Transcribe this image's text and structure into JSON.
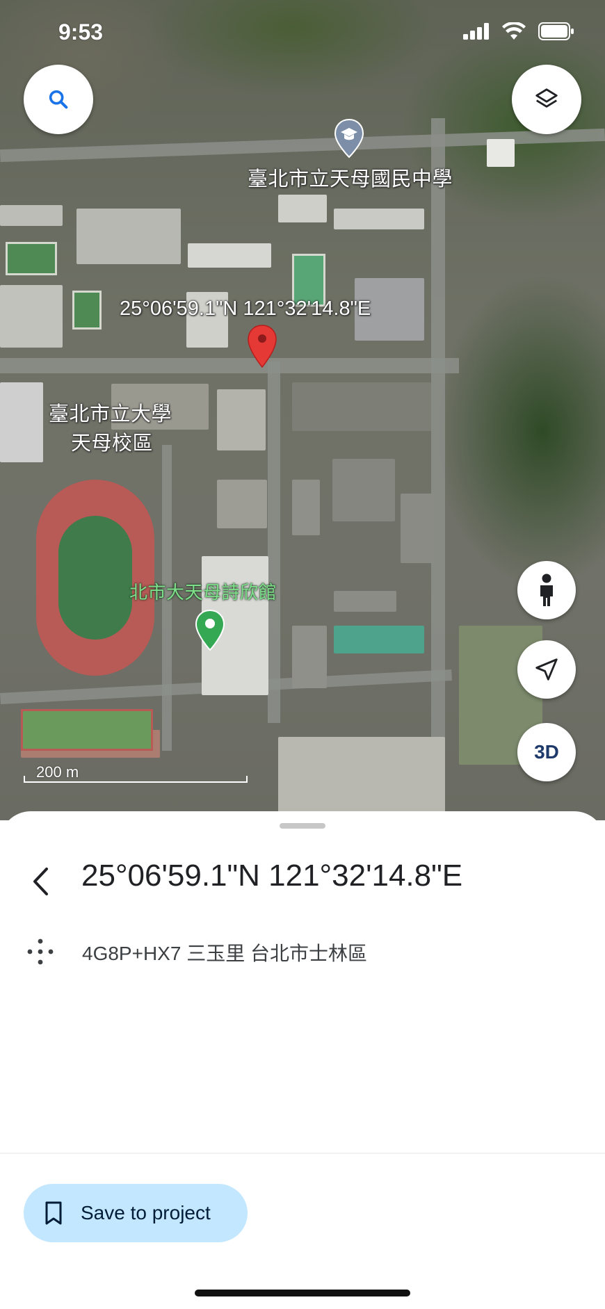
{
  "status_bar": {
    "time": "9:53"
  },
  "map": {
    "labels": {
      "junior_high": "臺北市立天母國民中學",
      "university_line1": "臺北市立大學",
      "university_line2": "天母校區",
      "poetry_hall": "北市大天母詩欣館",
      "coordinates": "25°06'59.1\"N 121°32'14.8\"E"
    },
    "scale": "200 m",
    "buttons": {
      "three_d": "3D"
    }
  },
  "sheet": {
    "title": "25°06'59.1\"N 121°32'14.8\"E",
    "plus_code": "4G8P+HX7 三玉里 台北市士林區",
    "save_button": "Save to project"
  },
  "colors": {
    "accent": "#1a73e8",
    "save_bg": "#c2e7ff",
    "pin_red": "#e53935",
    "pin_green": "#34a853"
  }
}
